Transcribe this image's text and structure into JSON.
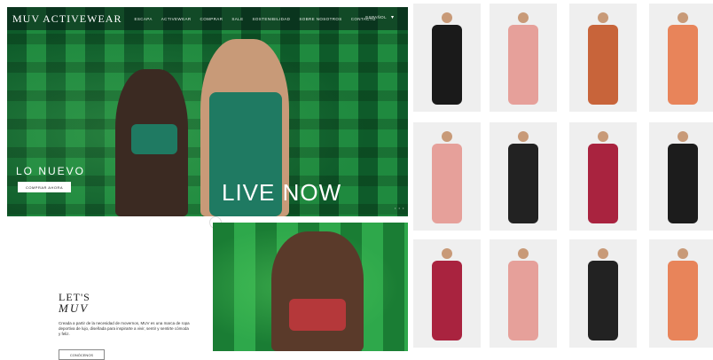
{
  "brand": {
    "logo": "MUV ACTIVEWEAR"
  },
  "nav": {
    "items": [
      "ESCAPA",
      "ACTIVEWEAR",
      "COMPRAR",
      "SALE",
      "SOSTENIBILIDAD",
      "SOBRE NOSOTROS",
      "CONTACTO"
    ],
    "language": "ESPAÑOL"
  },
  "hero": {
    "tag": "LO NUEVO",
    "cta": "COMPRAR AHORA",
    "headline": "LIVE NOW"
  },
  "about": {
    "title_line1": "LET'S",
    "title_line2": "MUV",
    "text": "Creada a partir de la necesidad de movernos, MUV es una marca de ropa deportiva de lujo, diseñada para inspirarte a vivir, sentir y sentirte cómoda y feliz.",
    "cta": "CONÓCENOS"
  },
  "colors": {
    "accent_green": "#1f8a3f",
    "dark_green": "#0b4a22",
    "background": "#ffffff"
  },
  "products": [
    {
      "name": "black-jacket-joggers",
      "color": "#1a1a1a"
    },
    {
      "name": "pink-sweat-set",
      "color": "#e6a09a"
    },
    {
      "name": "orange-burgundy-bra",
      "color": "#c8643a"
    },
    {
      "name": "orange-jumpsuit",
      "color": "#e8845a"
    },
    {
      "name": "pink-joggers-set",
      "color": "#e6a09a"
    },
    {
      "name": "black-bra-leggings",
      "color": "#222222"
    },
    {
      "name": "orange-bra-burgundy-shorts",
      "color": "#a9233f"
    },
    {
      "name": "black-oversized-top",
      "color": "#1c1c1c"
    },
    {
      "name": "burgundy-bra-shorts",
      "color": "#a9233f"
    },
    {
      "name": "pink-pullover",
      "color": "#e6a09a"
    },
    {
      "name": "black-bra-leggings-2",
      "color": "#222222"
    },
    {
      "name": "orange-set-ball",
      "color": "#e8845a"
    }
  ]
}
